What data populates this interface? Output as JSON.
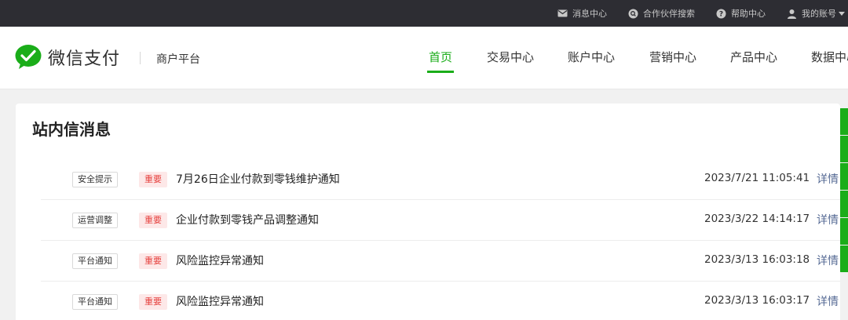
{
  "topbar": {
    "links": [
      {
        "label": "消息中心",
        "icon": "mail-icon"
      },
      {
        "label": "合作伙伴搜索",
        "icon": "search-circle-icon"
      },
      {
        "label": "帮助中心",
        "icon": "help-icon"
      },
      {
        "label": "我的账号",
        "icon": "user-icon"
      }
    ]
  },
  "header": {
    "logo_text": "微信支付",
    "platform": "商户平台",
    "nav": [
      {
        "label": "首页",
        "active": true
      },
      {
        "label": "交易中心"
      },
      {
        "label": "账户中心"
      },
      {
        "label": "营销中心"
      },
      {
        "label": "产品中心"
      },
      {
        "label": "数据中心"
      }
    ]
  },
  "colors": {
    "brand": "#1aad19",
    "link": "#576b95",
    "important": "#e64340"
  },
  "messages": {
    "title": "站内信消息",
    "detail_label": "详情",
    "important_label": "重要",
    "items": [
      {
        "category": "安全提示",
        "subject": "7月26日企业付款到零钱维护通知",
        "time": "2023/7/21 11:05:41"
      },
      {
        "category": "运营调整",
        "subject": "企业付款到零钱产品调整通知",
        "time": "2023/3/22 14:14:17"
      },
      {
        "category": "平台通知",
        "subject": "风险监控异常通知",
        "time": "2023/3/13 16:03:18"
      },
      {
        "category": "平台通知",
        "subject": "风险监控异常通知",
        "time": "2023/3/13 16:03:17"
      }
    ]
  }
}
